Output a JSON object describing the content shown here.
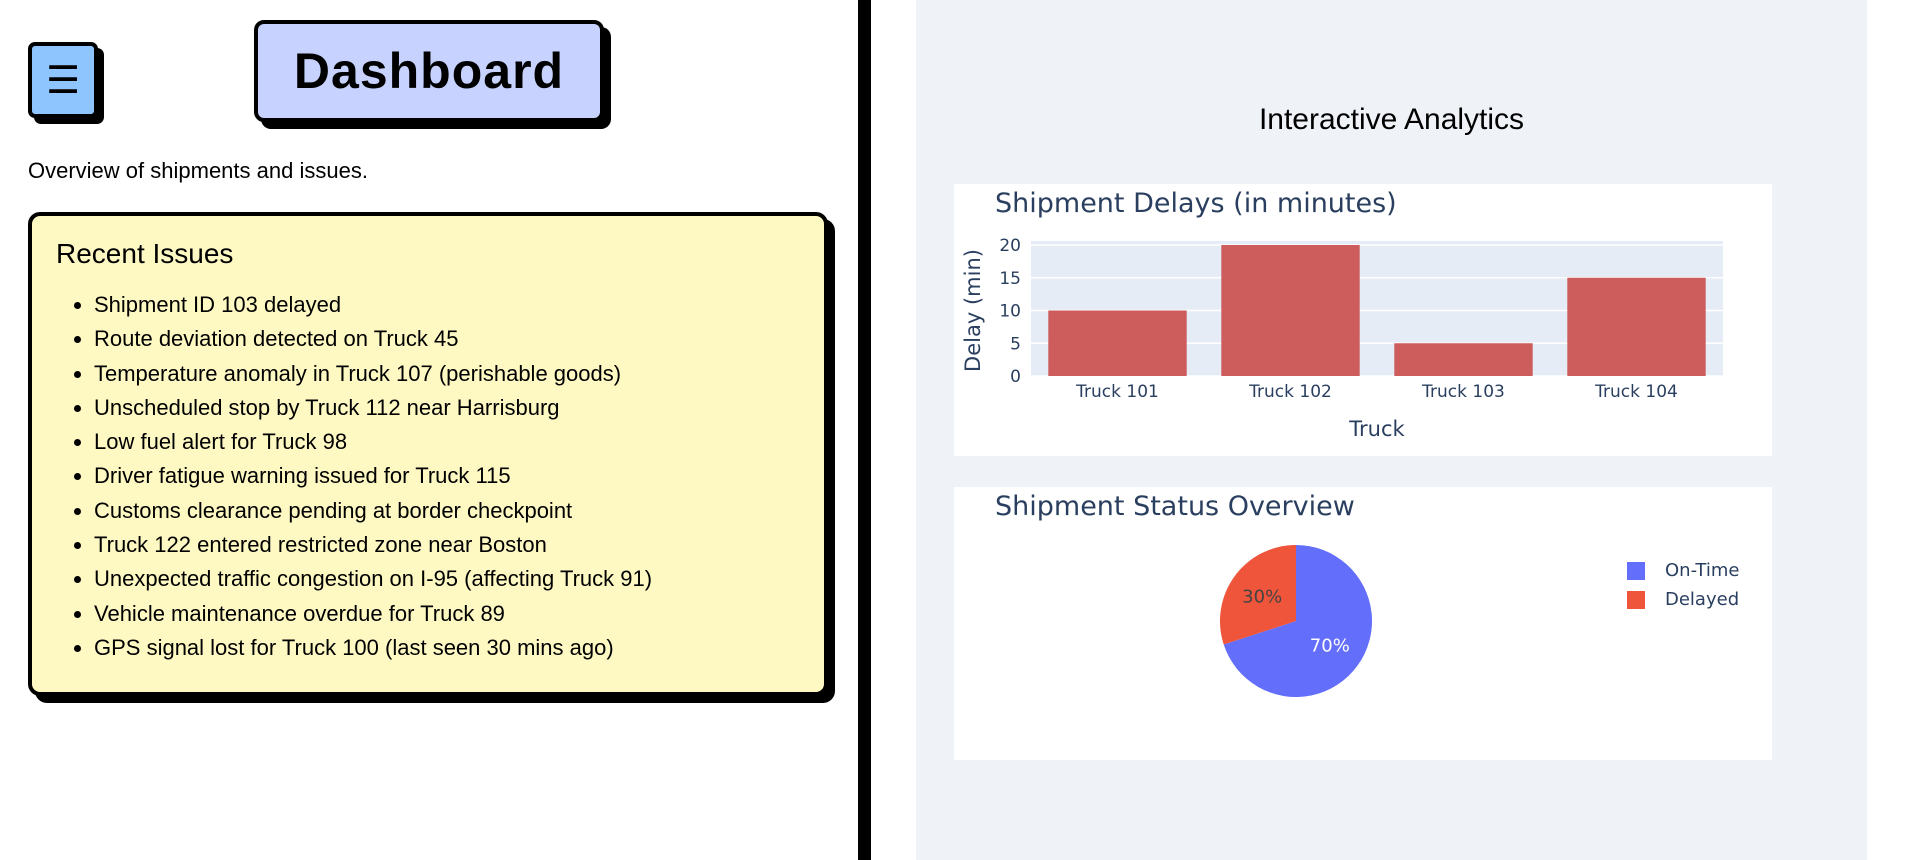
{
  "header": {
    "menu_icon": "hamburger-menu-icon",
    "menu_glyph": "☰",
    "title": "Dashboard",
    "subtitle": "Overview of shipments and issues."
  },
  "issues": {
    "heading": "Recent Issues",
    "items": [
      "Shipment ID 103 delayed",
      "Route deviation detected on Truck 45",
      "Temperature anomaly in Truck 107 (perishable goods)",
      "Unscheduled stop by Truck 112 near Harrisburg",
      "Low fuel alert for Truck 98",
      "Driver fatigue warning issued for Truck 115",
      "Customs clearance pending at border checkpoint",
      "Truck 122 entered restricted zone near Boston",
      "Unexpected traffic congestion on I-95 (affecting Truck 91)",
      "Vehicle maintenance overdue for Truck 89",
      "GPS signal lost for Truck 100 (last seen 30 mins ago)"
    ]
  },
  "analytics": {
    "title": "Interactive Analytics"
  },
  "colors": {
    "menu_button": "#8ec5ff",
    "title_box": "#c7d2fe",
    "issues_card": "#fef9c3",
    "bar": "#cd5c5c",
    "on_time": "#636efa",
    "delayed": "#ef553b",
    "plot_bg": "#e5ecf6",
    "panel_bg": "#eff3f8"
  },
  "chart_data": [
    {
      "type": "bar",
      "title": "Shipment Delays (in minutes)",
      "xlabel": "Truck",
      "ylabel": "Delay (min)",
      "categories": [
        "Truck 101",
        "Truck 102",
        "Truck 103",
        "Truck 104"
      ],
      "values": [
        10,
        20,
        5,
        15
      ],
      "ylim": [
        0,
        20
      ],
      "yticks": [
        0,
        5,
        10,
        15,
        20
      ],
      "grid": true
    },
    {
      "type": "pie",
      "title": "Shipment Status Overview",
      "labels": [
        "On-Time",
        "Delayed"
      ],
      "values": [
        70,
        30
      ],
      "value_labels": [
        "70%",
        "30%"
      ],
      "legend_position": "top-right"
    }
  ]
}
